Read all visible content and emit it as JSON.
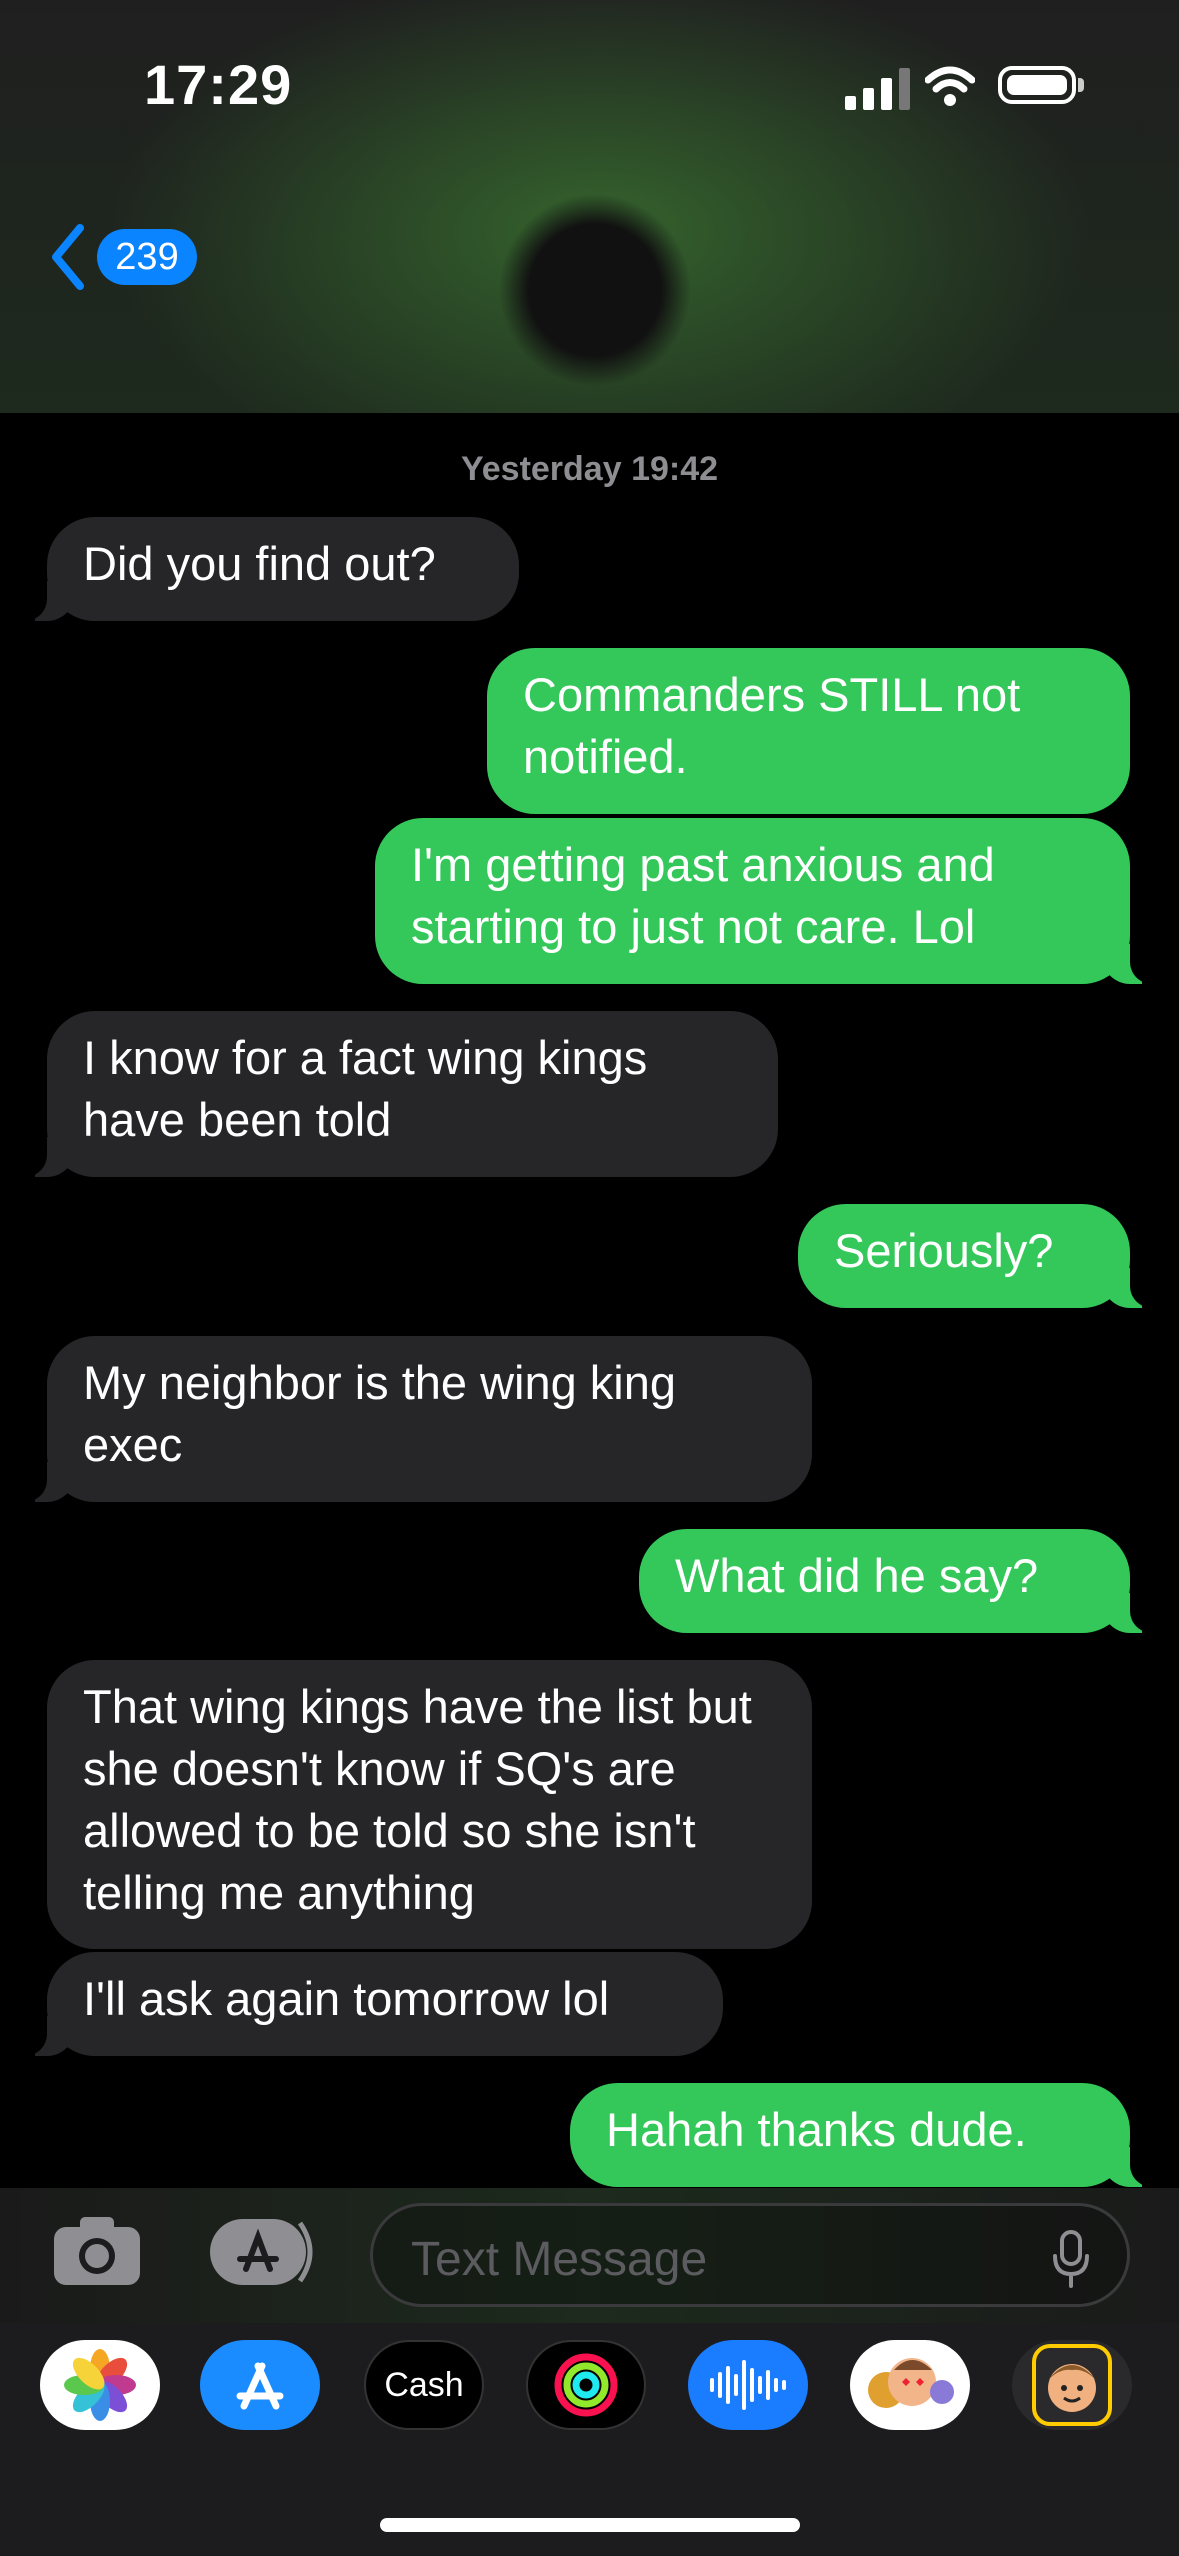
{
  "status_bar": {
    "time": "17:29"
  },
  "nav": {
    "back_count": "239"
  },
  "thread": {
    "timestamp": "Yesterday 19:42",
    "messages": [
      {
        "from": "them",
        "text": "Did you find out?"
      },
      {
        "from": "me",
        "text": "Commanders STILL not notified."
      },
      {
        "from": "me",
        "text": "I'm getting past anxious and starting to just not care. Lol"
      },
      {
        "from": "them",
        "text": "I know for a fact wing kings have been told"
      },
      {
        "from": "me",
        "text": "Seriously?"
      },
      {
        "from": "them",
        "text": "My neighbor is the wing king exec"
      },
      {
        "from": "me",
        "text": "What did he say?"
      },
      {
        "from": "them",
        "text": "That wing kings have the list but she doesn't know if SQ's are allowed to be told so she isn't telling me anything"
      },
      {
        "from": "them",
        "text": "I'll ask again tomorrow lol"
      },
      {
        "from": "me",
        "text": "Hahah thanks dude."
      }
    ]
  },
  "compose": {
    "placeholder": "Text Message"
  },
  "app_drawer": {
    "apps": [
      {
        "name": "photos-icon"
      },
      {
        "name": "app-store-icon"
      },
      {
        "name": "apple-cash-icon",
        "label": "Cash"
      },
      {
        "name": "activity-icon"
      },
      {
        "name": "audio-message-icon"
      },
      {
        "name": "memoji-stickers-icon"
      },
      {
        "name": "memoji-icon"
      }
    ]
  },
  "colors": {
    "outgoing": "#34c759",
    "incoming": "#262628",
    "accent": "#0a84ff"
  }
}
